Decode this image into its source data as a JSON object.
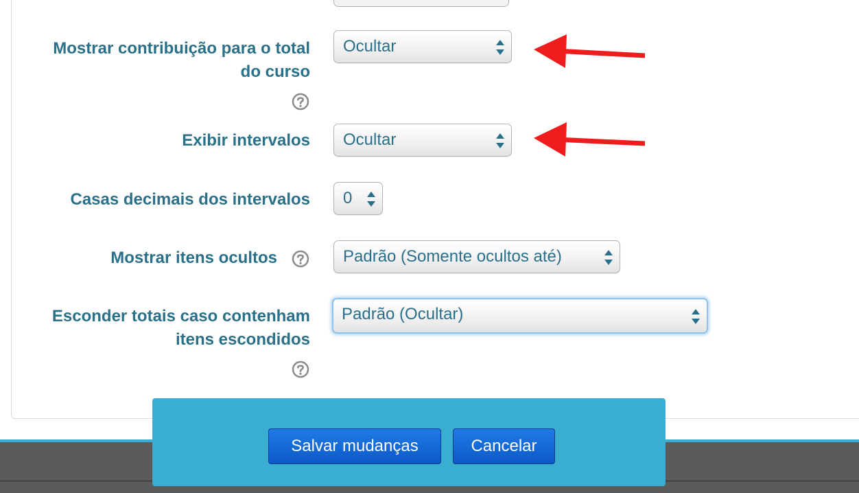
{
  "form": {
    "fields": [
      {
        "label": "Mostrar contribuição para o total do curso",
        "value": "Ocultar",
        "has_help": true
      },
      {
        "label": "Exibir intervalos",
        "value": "Ocultar",
        "has_help": false
      },
      {
        "label": "Casas decimais dos intervalos",
        "value": "0",
        "has_help": false
      },
      {
        "label": "Mostrar itens ocultos",
        "value": "Padrão (Somente ocultos até)",
        "has_help": true
      },
      {
        "label": "Esconder totais caso contenham itens escondidos",
        "value": "Padrão (Ocultar)",
        "has_help": true,
        "focused": true
      }
    ]
  },
  "actions": {
    "save_label": "Salvar mudanças",
    "cancel_label": "Cancelar"
  },
  "annotations": {
    "arrow_color": "#ee1c1c",
    "arrows_point_to": [
      "Mostrar contribuição para o total do curso",
      "Exibir intervalos"
    ]
  },
  "colors": {
    "label": "#2a7089",
    "action_bar": "#3aaed1",
    "button": "#0d58c6",
    "footer": "#5a5a5a"
  }
}
